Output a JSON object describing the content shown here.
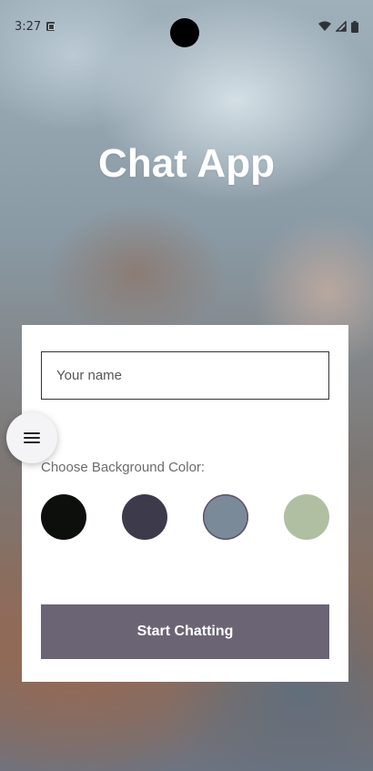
{
  "status_bar": {
    "time": "3:27",
    "icons": [
      "notification-icon",
      "wifi-icon",
      "signal-icon",
      "battery-icon"
    ]
  },
  "app": {
    "title": "Chat App"
  },
  "form": {
    "name_placeholder": "Your name",
    "name_value": "",
    "color_label": "Choose Background Color:",
    "colors": [
      {
        "name": "black",
        "hex": "#0d0f0d",
        "selected": false
      },
      {
        "name": "dark-purple",
        "hex": "#3d3a4b",
        "selected": false
      },
      {
        "name": "slate-blue",
        "hex": "#7b8a99",
        "selected": true
      },
      {
        "name": "sage-green",
        "hex": "#b0bfa2",
        "selected": false
      }
    ],
    "submit_label": "Start Chatting"
  },
  "fab": {
    "icon": "menu-icon"
  },
  "theme": {
    "button_color": "#6a6474",
    "card_color": "#ffffff",
    "title_color": "#ffffff"
  }
}
